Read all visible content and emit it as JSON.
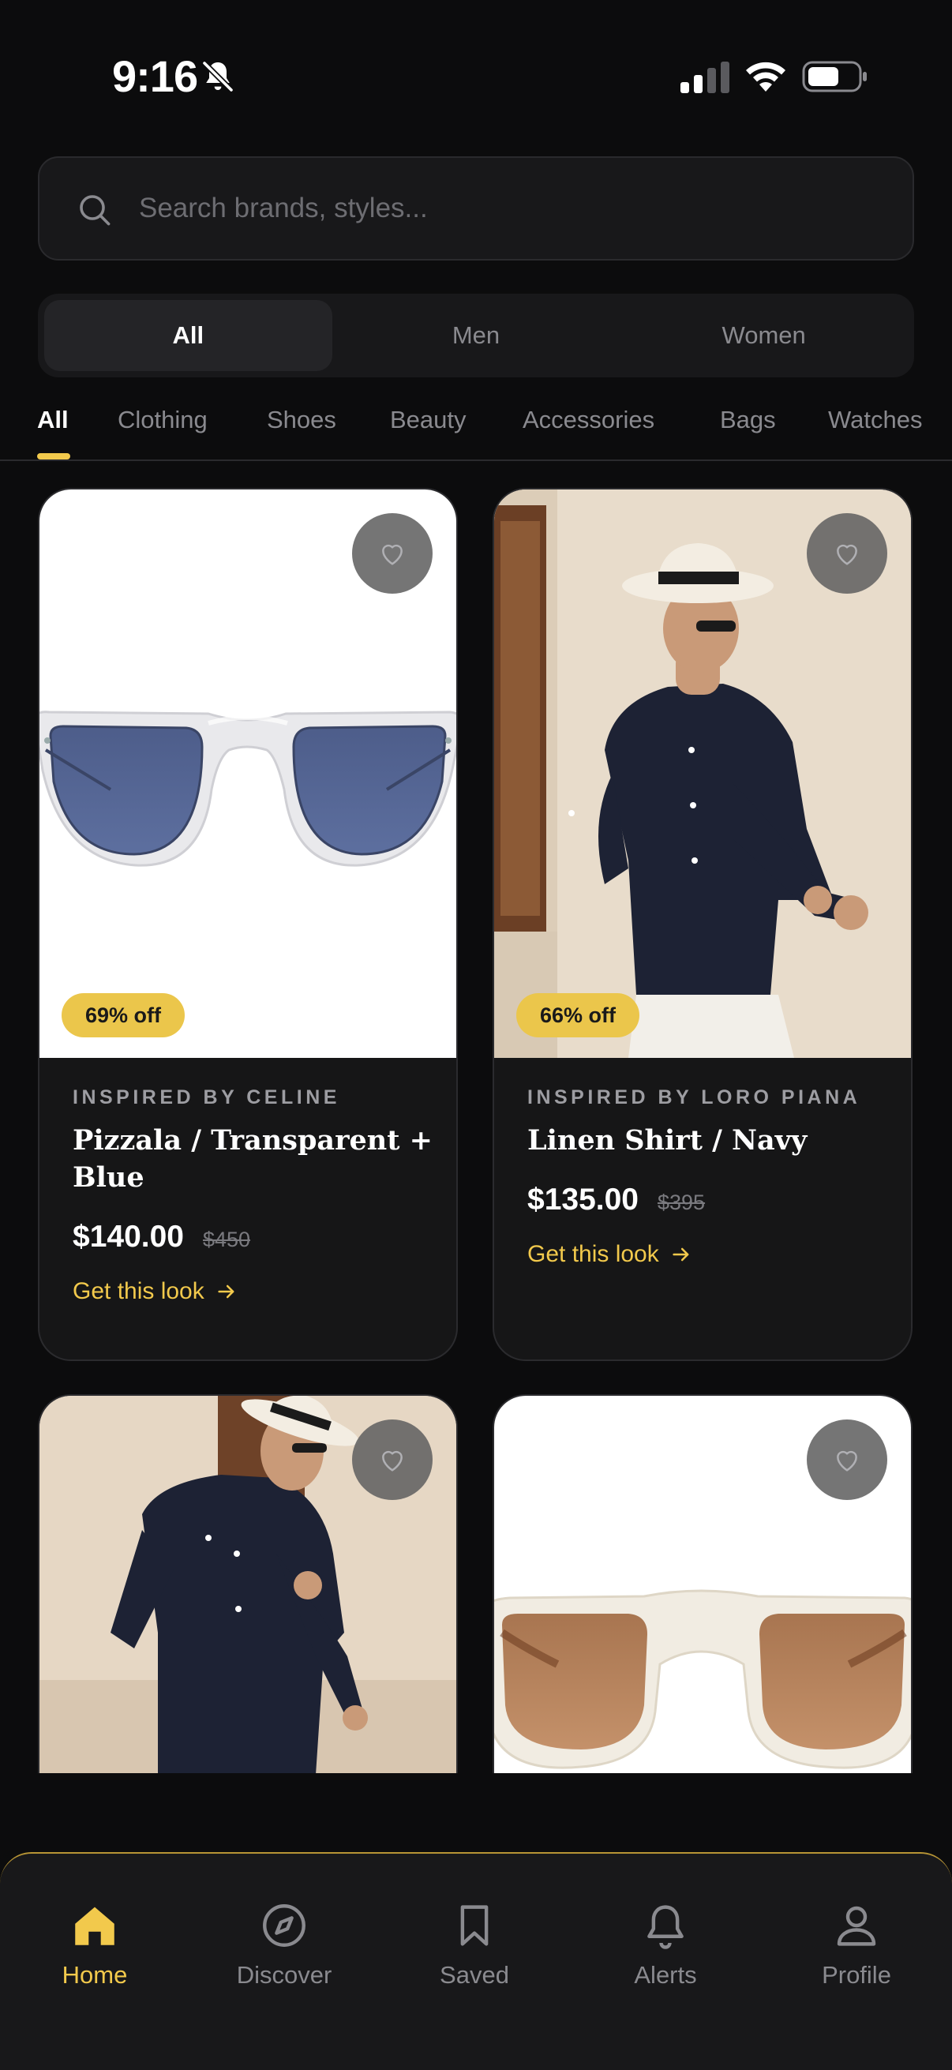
{
  "status_bar": {
    "time": "9:16"
  },
  "search": {
    "placeholder": "Search brands, styles..."
  },
  "gender_filter": {
    "options": [
      "All",
      "Men",
      "Women"
    ],
    "selected": "All"
  },
  "categories": {
    "items": [
      "All",
      "Clothing",
      "Shoes",
      "Beauty",
      "Accessories",
      "Bags",
      "Watches"
    ],
    "selected": "All"
  },
  "products": [
    {
      "brand": "INSPIRED BY CELINE",
      "title": "Pizzala / Transparent + Blue",
      "price": "$140.00",
      "original_price": "$450",
      "discount": "69% off",
      "cta": "Get this look"
    },
    {
      "brand": "INSPIRED BY LORO PIANA",
      "title": "Linen Shirt / Navy",
      "price": "$135.00",
      "original_price": "$395",
      "discount": "66% off",
      "cta": "Get this look"
    }
  ],
  "bottom_nav": {
    "items": [
      "Home",
      "Discover",
      "Saved",
      "Alerts",
      "Profile"
    ],
    "active": "Home"
  },
  "colors": {
    "accent": "#f2c94c",
    "background": "#0c0c0d",
    "card": "#161617",
    "badge": "#ebc64b"
  }
}
